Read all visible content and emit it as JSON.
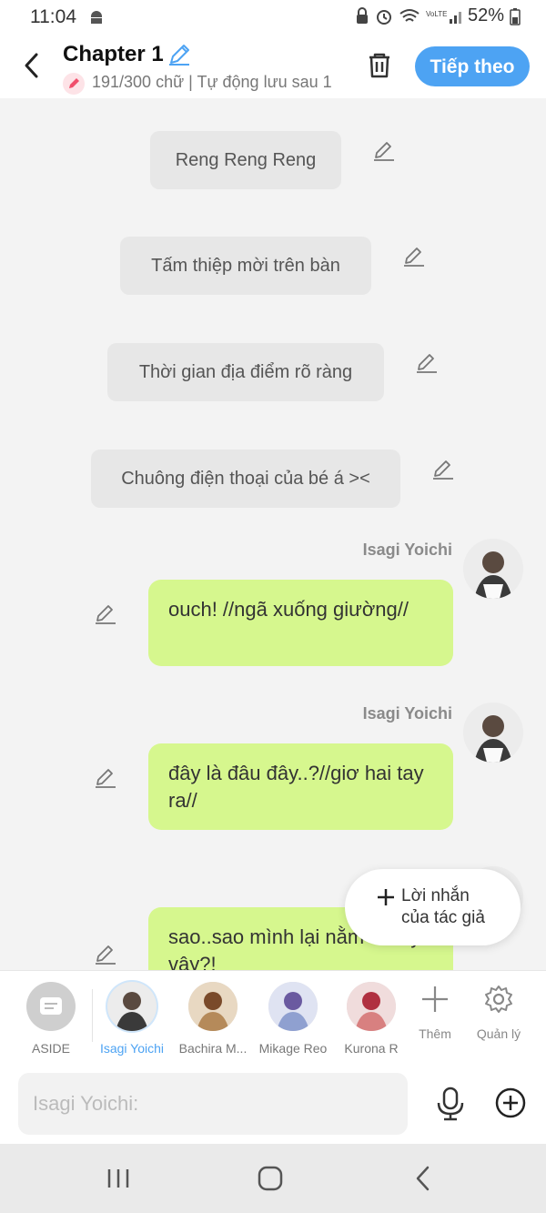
{
  "status": {
    "time": "11:04",
    "battery": "52%"
  },
  "header": {
    "title": "Chapter 1",
    "subtitle": "191/300 chữ | Tự động lưu sau 1",
    "next_label": "Tiếp theo"
  },
  "chat": {
    "narrations": [
      "Reng Reng Reng",
      "Tấm thiệp mời trên bàn",
      "Thời gian địa điểm rõ ràng",
      "Chuông điện thoại của bé á ><"
    ],
    "messages": [
      {
        "sender": "Isagi Yoichi",
        "text": "ouch! //ngã xuống giường//"
      },
      {
        "sender": "Isagi Yoichi",
        "text": "đây là đâu đây..?//giơ hai tay ra//"
      },
      {
        "sender": "Isagi Yoichi",
        "text": "sao..sao mình lại nằm ở đây vậy?!"
      }
    ]
  },
  "fab": {
    "line1": "Lời nhắn",
    "line2": "của tác giả"
  },
  "characters": [
    {
      "name": "ASIDE"
    },
    {
      "name": "Isagi Yoichi"
    },
    {
      "name": "Bachira M..."
    },
    {
      "name": "Mikage Reo"
    },
    {
      "name": "Kurona R"
    }
  ],
  "tools": {
    "add_label": "Thêm",
    "manage_label": "Quản lý"
  },
  "input": {
    "placeholder": "Isagi Yoichi:"
  },
  "colors": {
    "accent": "#4da3f3",
    "bubble": "#d6f78e",
    "narration": "#e7e7e7"
  }
}
